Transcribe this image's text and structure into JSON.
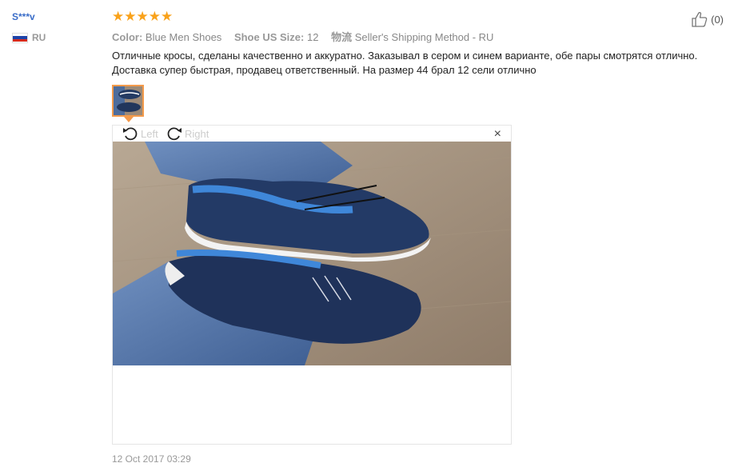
{
  "review": {
    "user_name": "S***v",
    "country_code": "RU",
    "rating_stars": "★★★★★",
    "rating": 5,
    "attributes": [
      {
        "key": "Color:",
        "value": "Blue Men Shoes"
      },
      {
        "key": "Shoe US Size:",
        "value": "12"
      },
      {
        "key": "物流",
        "value": "Seller's Shipping Method - RU"
      }
    ],
    "helpful_count": "(0)",
    "text_line1": "Отличные кросы, сделаны качественно и аккуратно. Заказывал в сером и синем варианте, обе пары смотрятся отлично.",
    "text_line2": "Доставка супер быстрая, продавец ответственный. На размер 44 брал 12 сели отлично",
    "date": "12 Oct 2017 03:29"
  },
  "viewer": {
    "rotate_left_label": "Left",
    "rotate_right_label": "Right",
    "close_glyph": "×"
  },
  "icons": {
    "thumbs_up": "thumbs-up-icon",
    "rotate_left": "rotate-left-icon",
    "rotate_right": "rotate-right-icon",
    "close": "close-icon",
    "flag": "russia-flag-icon"
  },
  "colors": {
    "star": "#f9a21b",
    "user_name": "#3a6dc8",
    "thumb_border": "#f39a4b"
  }
}
